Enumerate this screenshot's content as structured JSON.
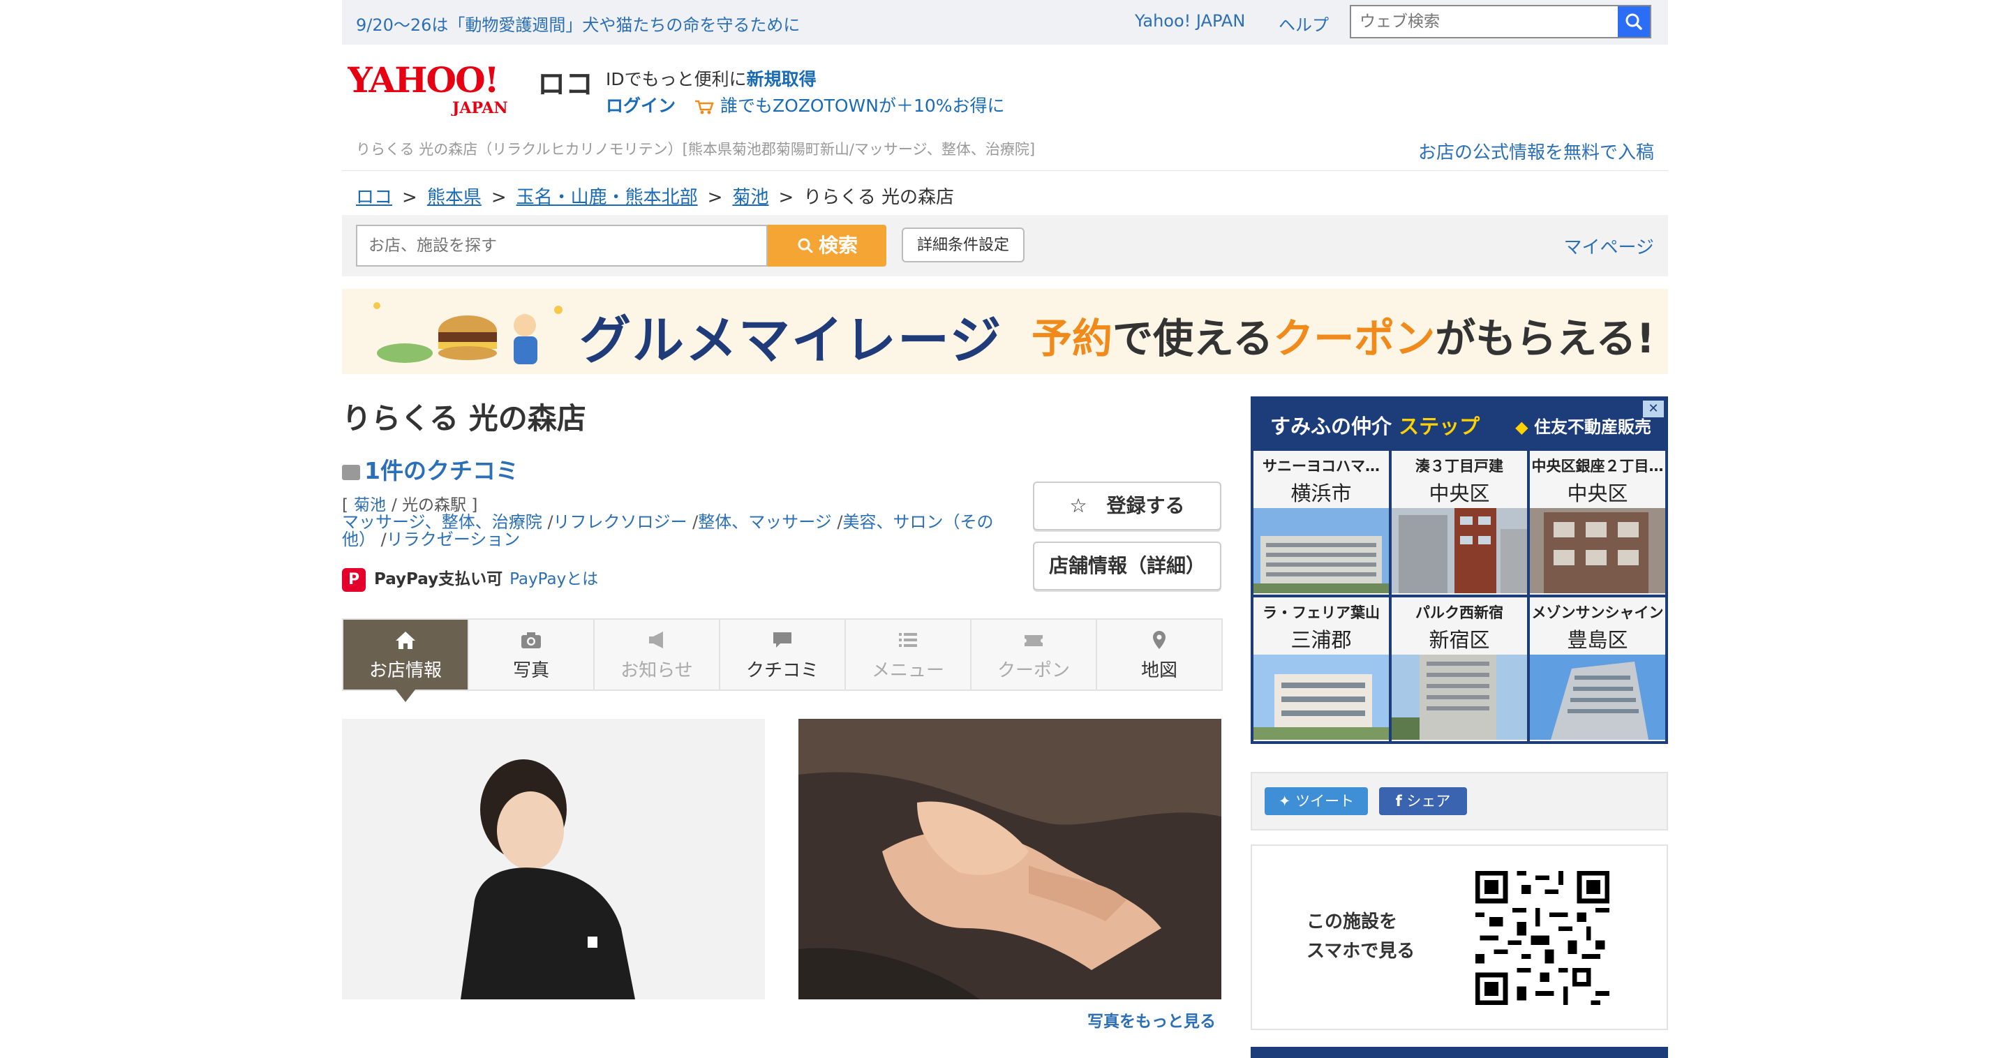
{
  "topbar": {
    "notice": "9/20〜26は「動物愛護週間」犬や猫たちの命を守るために",
    "yahoo_link": "Yahoo! JAPAN",
    "help_link": "ヘルプ",
    "web_search_placeholder": "ウェブ検索"
  },
  "header": {
    "logo_text": "YAHOO! JAPAN",
    "logo_suffix": "ロコ",
    "id_prefix": "IDでもっと便利に",
    "signup": "新規取得",
    "login": "ログイン",
    "promo": "誰でもZOZOTOWNが＋10%お得に",
    "store_meta": "りらくる 光の森店（リラクルヒカリノモリテン）[熊本県菊池郡菊陽町新山/マッサージ、整体、治療院]",
    "post_link": "お店の公式情報を無料で入稿"
  },
  "breadcrumb": [
    "ロコ",
    "熊本県",
    "玉名・山鹿・熊本北部",
    "菊池",
    "りらくる 光の森店"
  ],
  "search": {
    "placeholder": "お店、施設を探す",
    "button": "検索",
    "detail": "詳細条件設定",
    "mypage": "マイページ"
  },
  "banner": {
    "main": "グルメマイレージ",
    "sub_1": "予約",
    "sub_2": "で使える",
    "sub_3": "クーポン",
    "sub_4": "がもらえる!"
  },
  "store": {
    "name": "りらくる 光の森店",
    "reviews": "1件のクチコミ",
    "area": "菊池",
    "station": "光の森駅",
    "categories": [
      "マッサージ、整体、治療院",
      "リフレクソロジー",
      "整体、マッサージ",
      "美容、サロン（その他）",
      "リラクゼーション"
    ],
    "paypay": "PayPay支払い可",
    "paypay_link": "PayPayとは",
    "register": "☆　登録する",
    "info_detail": "店舗情報（詳細）",
    "more_photos": "写真をもっと見る"
  },
  "tabs": [
    {
      "label": "お店情報",
      "icon": "home-icon",
      "active": true
    },
    {
      "label": "写真",
      "icon": "camera-icon"
    },
    {
      "label": "お知らせ",
      "icon": "megaphone-icon",
      "disabled": true
    },
    {
      "label": "クチコミ",
      "icon": "speech-bubble-icon"
    },
    {
      "label": "メニュー",
      "icon": "list-icon",
      "disabled": true
    },
    {
      "label": "クーポン",
      "icon": "ticket-icon",
      "disabled": true
    },
    {
      "label": "地図",
      "icon": "map-pin-icon"
    }
  ],
  "ad": {
    "brand_1": "すみふの仲介",
    "brand_2": "ステップ",
    "partner": "住友不動産販売",
    "cells": [
      {
        "name": "サニーヨコハマ…",
        "city": "横浜市"
      },
      {
        "name": "湊３丁目戸建",
        "city": "中央区"
      },
      {
        "name": "中央区銀座２丁目…",
        "city": "中央区"
      },
      {
        "name": "ラ・フェリア葉山",
        "city": "三浦郡"
      },
      {
        "name": "パルク西新宿",
        "city": "新宿区"
      },
      {
        "name": "メゾンサンシャイン",
        "city": "豊島区"
      }
    ]
  },
  "share": {
    "tweet": "ツイート",
    "facebook": "シェア"
  },
  "qr": {
    "line1": "この施設を",
    "line2": "スマホで見る"
  },
  "colors": {
    "link": "#1a6bb5",
    "accent_orange": "#f5a534",
    "tab_active": "#6b6151",
    "ad_navy": "#1c3d7a"
  }
}
